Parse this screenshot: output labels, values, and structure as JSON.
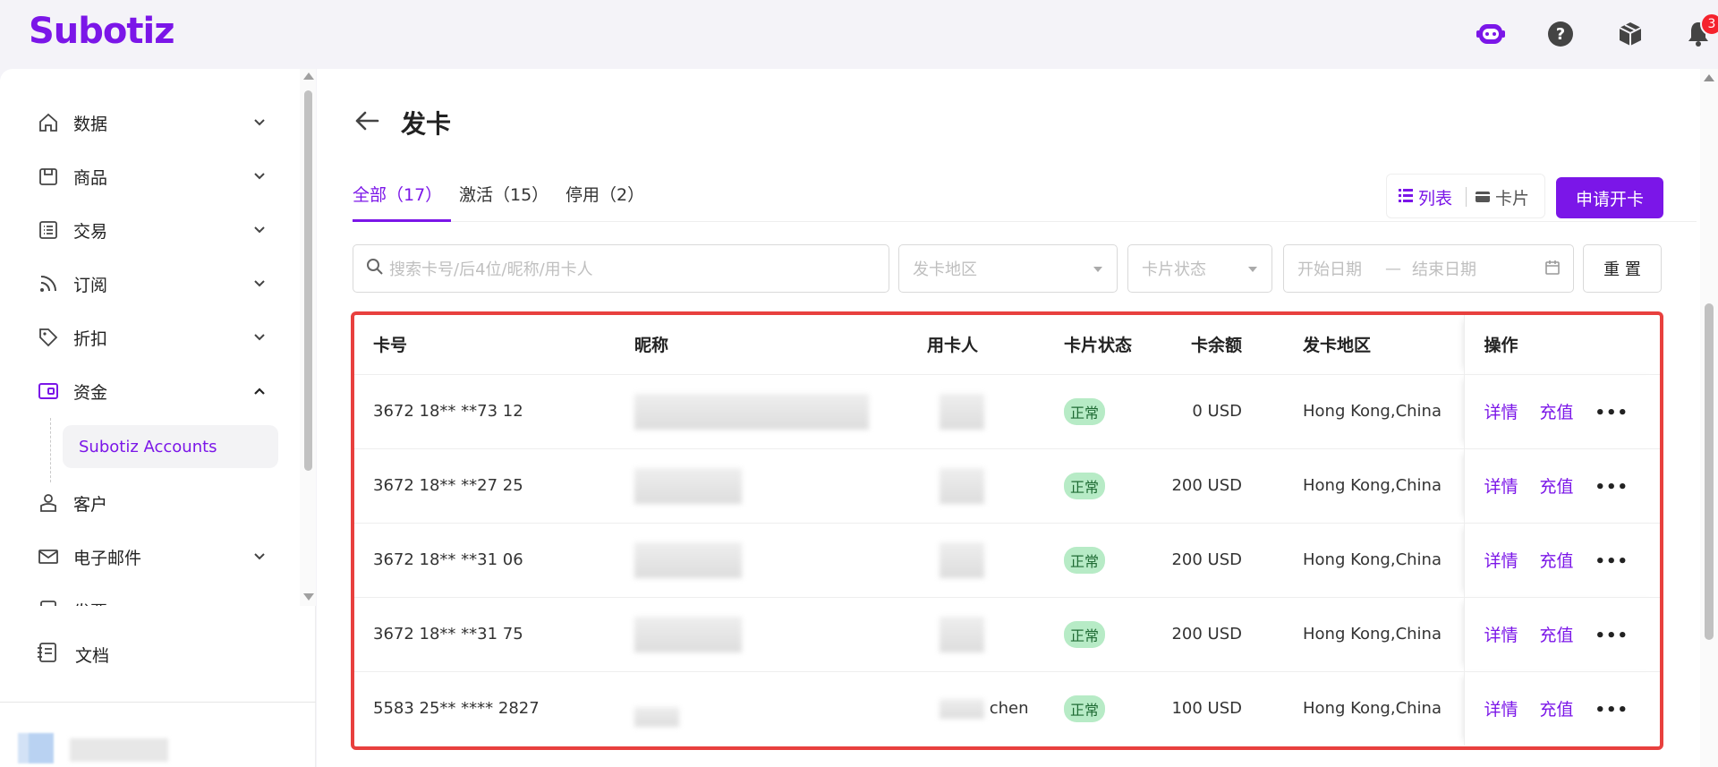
{
  "app": {
    "logo_text": "Subotiz",
    "accent_color": "#7b16e8"
  },
  "topbar": {
    "icons": [
      "bot-icon",
      "help-icon",
      "package-icon",
      "bell-icon"
    ],
    "notification_count": "3"
  },
  "sidebar": {
    "items": [
      {
        "label": "数据",
        "icon": "home-icon",
        "expanded": false
      },
      {
        "label": "商品",
        "icon": "store-icon",
        "expanded": false
      },
      {
        "label": "交易",
        "icon": "list-icon",
        "expanded": false
      },
      {
        "label": "订阅",
        "icon": "rss-icon",
        "expanded": false
      },
      {
        "label": "折扣",
        "icon": "tag-icon",
        "expanded": false
      },
      {
        "label": "资金",
        "icon": "wallet-icon",
        "expanded": true
      },
      {
        "label": "客户",
        "icon": "user-icon",
        "expanded": false
      },
      {
        "label": "电子邮件",
        "icon": "mail-icon",
        "expanded": false
      },
      {
        "label": "发票",
        "icon": "invoice-icon",
        "expanded": false
      }
    ],
    "sub_item": "Subotiz Accounts",
    "docs_label": "文档"
  },
  "page": {
    "title": "发卡",
    "tabs": [
      {
        "label": "全部（17）",
        "active": true
      },
      {
        "label": "激活（15）",
        "active": false
      },
      {
        "label": "停用（2）",
        "active": false
      }
    ],
    "view_toggle": {
      "list_label": "列表",
      "card_label": "卡片",
      "selected": "list"
    },
    "apply_button": "申请开卡"
  },
  "filters": {
    "search_placeholder": "搜索卡号/后4位/昵称/用卡人",
    "region_placeholder": "发卡地区",
    "status_placeholder": "卡片状态",
    "start_date_placeholder": "开始日期",
    "date_separator": "—",
    "end_date_placeholder": "结束日期",
    "reset_label": "重 置"
  },
  "table": {
    "columns": [
      "卡号",
      "昵称",
      "用卡人",
      "卡片状态",
      "卡余额",
      "发卡地区",
      "操作"
    ],
    "rows": [
      {
        "card_no": "3672 18** **73 12",
        "holder_suffix": "",
        "status": "正常",
        "balance": "0 USD",
        "region": "Hong Kong,China"
      },
      {
        "card_no": "3672 18** **27 25",
        "holder_suffix": "",
        "status": "正常",
        "balance": "200 USD",
        "region": "Hong Kong,China"
      },
      {
        "card_no": "3672 18** **31 06",
        "holder_suffix": "",
        "status": "正常",
        "balance": "200 USD",
        "region": "Hong Kong,China"
      },
      {
        "card_no": "3672 18** **31 75",
        "holder_suffix": "",
        "status": "正常",
        "balance": "200 USD",
        "region": "Hong Kong,China"
      },
      {
        "card_no": "5583 25** **** 2827",
        "holder_suffix": "chen",
        "status": "正常",
        "balance": "100 USD",
        "region": "Hong Kong,China"
      }
    ],
    "actions": {
      "detail": "详情",
      "recharge": "充值",
      "more": "•••"
    }
  }
}
